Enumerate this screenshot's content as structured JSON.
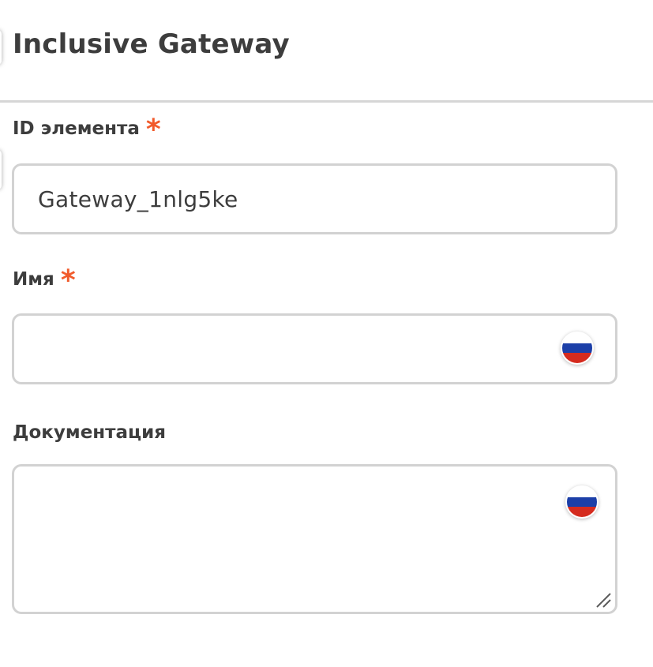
{
  "header": {
    "title": "Inclusive Gateway"
  },
  "fields": {
    "id": {
      "label": "ID элемента",
      "required_mark": "*",
      "value": "Gateway_1nlg5ke"
    },
    "name": {
      "label": "Имя",
      "required_mark": "*",
      "value": "",
      "language_icon": "russian-flag-icon"
    },
    "documentation": {
      "label": "Документация",
      "value": "",
      "language_icon": "russian-flag-icon"
    }
  },
  "colors": {
    "text": "#3d3d3d",
    "required": "#f15a2b",
    "border": "#d2d2d2",
    "flag_white": "#ffffff",
    "flag_blue": "#1c3fa8",
    "flag_red": "#d52b1e"
  }
}
